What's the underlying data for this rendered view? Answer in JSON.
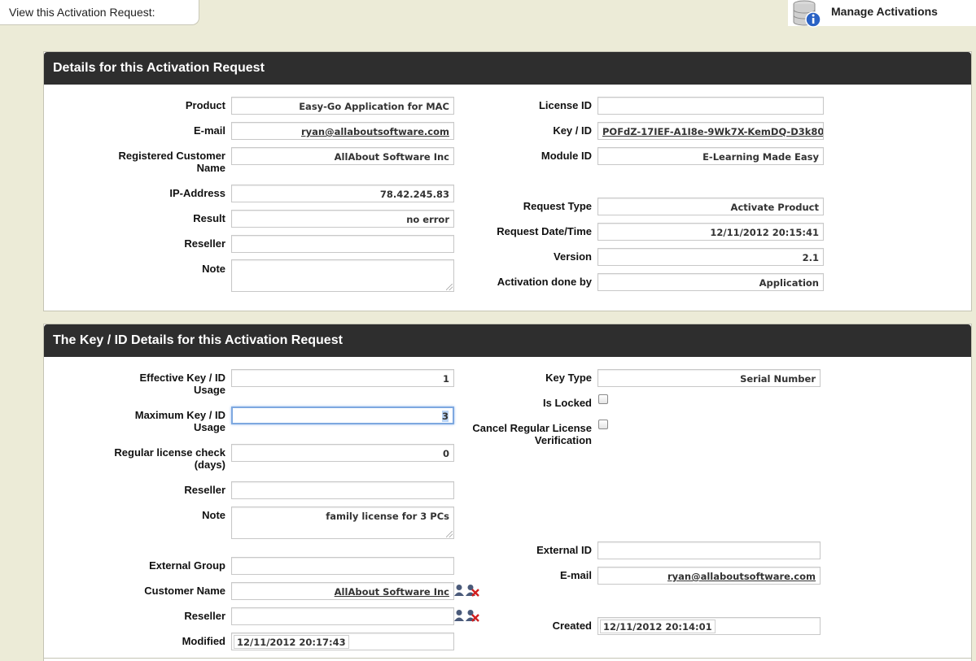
{
  "topbar": {
    "view_tab": "View this Activation Request:",
    "manage_label": "Manage Activations",
    "manage_icon": "database-info-icon"
  },
  "details": {
    "title": "Details for this Activation Request",
    "product": {
      "label": "Product",
      "value": "Easy-Go Application for MAC"
    },
    "email": {
      "label": "E-mail",
      "value": "ryan@allaboutsoftware.com"
    },
    "customer": {
      "label1": "Registered Customer",
      "label2": "Name",
      "value": "AllAbout Software Inc"
    },
    "ip": {
      "label": "IP-Address",
      "value": "78.42.245.83"
    },
    "result": {
      "label": "Result",
      "value": "no error"
    },
    "reseller": {
      "label": "Reseller",
      "value": ""
    },
    "note": {
      "label": "Note",
      "value": ""
    },
    "license_id": {
      "label": "License ID",
      "value": ""
    },
    "key_id": {
      "label": "Key / ID",
      "value": "POFdZ-17IEF-A1I8e-9Wk7X-KemDQ-D3k80"
    },
    "module_id": {
      "label": "Module ID",
      "value": "E-Learning Made Easy"
    },
    "request_type": {
      "label": "Request Type",
      "value": "Activate Product"
    },
    "request_date": {
      "label": "Request Date/Time",
      "value": "12/11/2012 20:15:41"
    },
    "version": {
      "label": "Version",
      "value": "2.1"
    },
    "activation_by": {
      "label": "Activation done by",
      "value": "Application"
    }
  },
  "key_details": {
    "title": "The Key / ID Details for this Activation Request",
    "effective_usage": {
      "label1": "Effective Key / ID",
      "label2": "Usage",
      "value": "1"
    },
    "max_usage": {
      "label1": "Maximum Key / ID",
      "label2": "Usage",
      "value": "3"
    },
    "license_check": {
      "label1": "Regular license check",
      "label2": "(days)",
      "value": "0"
    },
    "reseller": {
      "label": "Reseller",
      "value": ""
    },
    "note": {
      "label": "Note",
      "value": "family license for 3 PCs"
    },
    "external_group": {
      "label": "External Group",
      "value": ""
    },
    "customer_name": {
      "label": "Customer Name",
      "value": "AllAbout Software Inc"
    },
    "reseller2": {
      "label": "Reseller",
      "value": ""
    },
    "modified": {
      "label": "Modified",
      "value": "12/11/2012 20:17:43"
    },
    "key_type": {
      "label": "Key Type",
      "value": "Serial Number"
    },
    "is_locked": {
      "label": "Is Locked",
      "checked": false
    },
    "cancel_verification": {
      "label1": "Cancel Regular License",
      "label2": "Verification",
      "checked": false
    },
    "external_id": {
      "label": "External ID",
      "value": ""
    },
    "email": {
      "label": "E-mail",
      "value": "ryan@allaboutsoftware.com"
    },
    "created": {
      "label": "Created",
      "value": "12/11/2012 20:14:01"
    }
  },
  "icons": {
    "customer_select": "user-select-icon",
    "customer_remove": "user-remove-icon"
  }
}
